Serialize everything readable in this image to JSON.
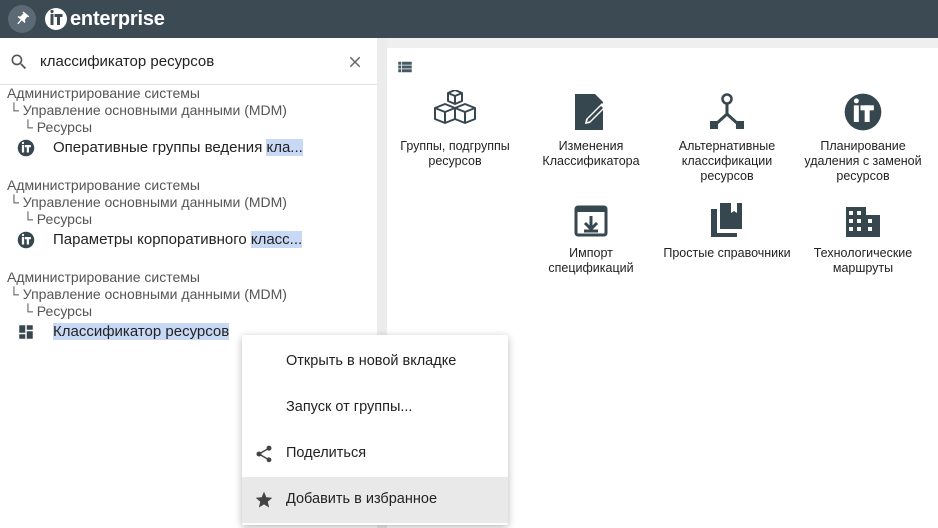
{
  "app": {
    "logo_text": "enterprise"
  },
  "search": {
    "value": "классификатор ресурсов",
    "placeholder": ""
  },
  "results": [
    {
      "path": [
        "Администрирование системы",
        "└ Управление основными данными (MDM)",
        "└ Ресурсы"
      ],
      "title_prefix": "Оперативные группы ведения ",
      "title_highlight": "кла...",
      "title_suffix": "",
      "icon": "it-logo-icon"
    },
    {
      "path": [
        "Администрирование системы",
        "└ Управление основными данными (MDM)",
        "└ Ресурсы"
      ],
      "title_prefix": "Параметры корпоративного ",
      "title_highlight": "класс...",
      "title_suffix": "",
      "icon": "it-logo-icon"
    },
    {
      "path": [
        "Администрирование системы",
        "└ Управление основными данными (MDM)",
        "└ Ресурсы"
      ],
      "title_prefix": "",
      "title_highlight": "Классификатор",
      "title_suffix": " ресурсов",
      "icon": "dashboard-icon"
    }
  ],
  "tiles": [
    {
      "label": "Группы, подгруппы ресурсов",
      "icon": "cubes-icon"
    },
    {
      "label": "Изменения Классификатора",
      "icon": "edit-document-icon"
    },
    {
      "label": "Альтернативные классификации ресурсов",
      "icon": "hierarchy-icon"
    },
    {
      "label": "Планирование удаления с заменой ресурсов",
      "icon": "it-logo-icon"
    },
    {
      "label": "Импорт спецификаций",
      "icon": "import-icon"
    },
    {
      "label": "Простые справочники",
      "icon": "books-icon"
    },
    {
      "label": "Технологические маршруты",
      "icon": "building-icon"
    }
  ],
  "context_menu": {
    "items": [
      {
        "label": "Открыть в новой вкладке",
        "icon": ""
      },
      {
        "label": "Запуск от группы...",
        "icon": ""
      },
      {
        "label": "Поделиться",
        "icon": "share-icon"
      },
      {
        "label": "Добавить в избранное",
        "icon": "star-icon"
      }
    ],
    "active_index": 3
  },
  "colors": {
    "topbar": "#3c4a54",
    "icon_dark": "#37474f",
    "highlight": "#c8d9f5"
  }
}
